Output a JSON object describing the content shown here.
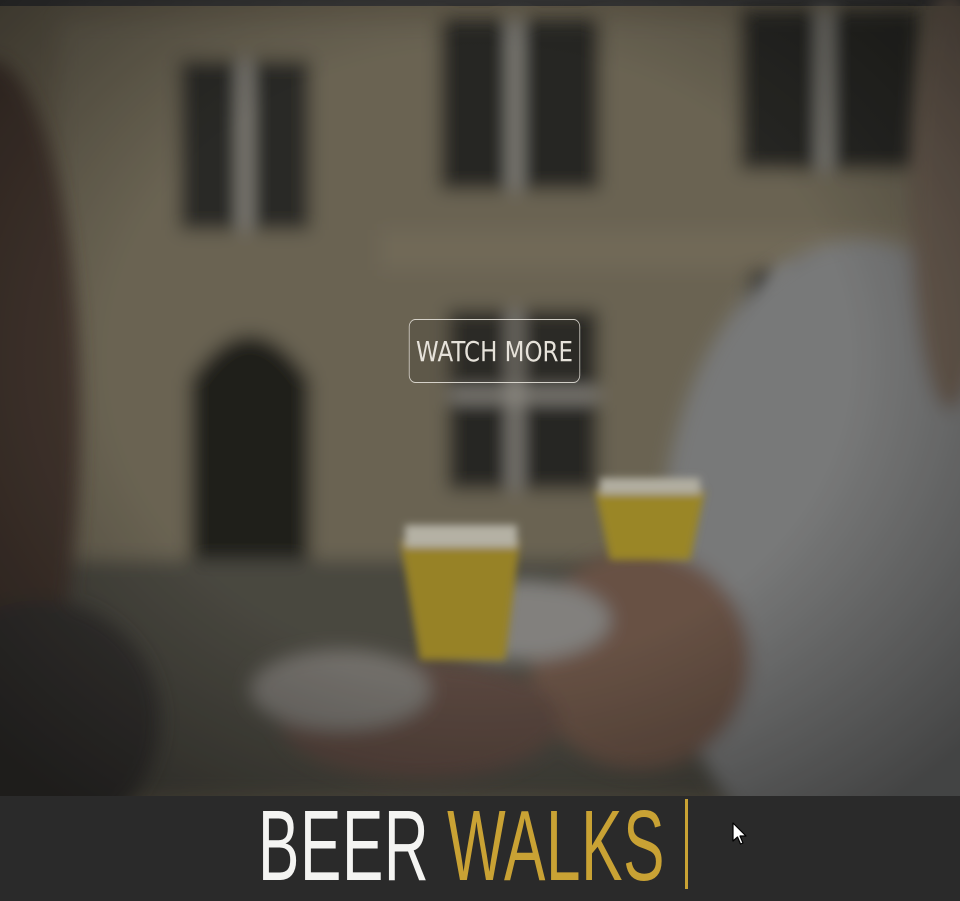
{
  "hero": {
    "watch_button_label": "WATCH MORE"
  },
  "banner": {
    "title_word_1": "BEER",
    "title_word_2": "WALKS"
  },
  "colors": {
    "accent": "#c9a234",
    "banner_bg": "#2a2a2a",
    "title_white": "#f4f4f2"
  },
  "icons": {
    "pointer": "mouse-cursor-icon"
  }
}
